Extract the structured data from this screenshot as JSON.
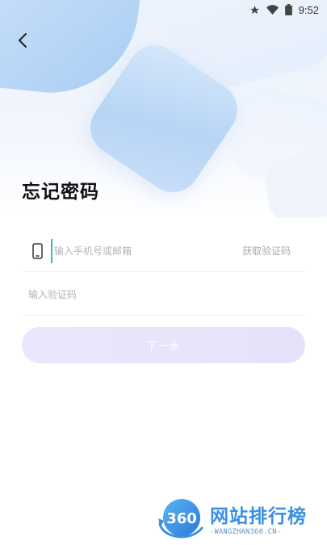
{
  "status_bar": {
    "time": "9:52",
    "icons": [
      "star-icon",
      "wifi-icon",
      "battery-icon"
    ]
  },
  "header": {
    "back_icon": "chevron-left-icon",
    "title": "忘记密码"
  },
  "form": {
    "phone": {
      "icon": "phone-icon",
      "placeholder": "输入手机号或邮箱",
      "value": "",
      "get_code_label": "获取验证码"
    },
    "code": {
      "placeholder": "输入验证码",
      "value": ""
    },
    "next_button_label": "下一步"
  },
  "watermark": {
    "logo_text": "360",
    "title": "网站排行榜",
    "subtitle": "-WANGZHAN360.CN-"
  },
  "colors": {
    "accent_cursor": "#42b8a8",
    "button_bg": "#e9e5fb",
    "watermark_blue": "#3a8fe0",
    "title_text": "#111111",
    "placeholder_text": "#b3b3ba"
  }
}
